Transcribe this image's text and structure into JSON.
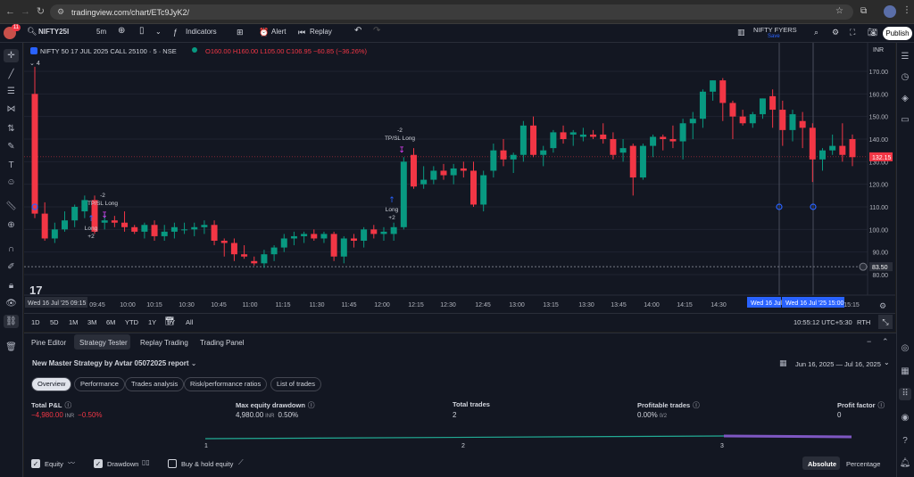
{
  "browser": {
    "url": "tradingview.com/chart/ETc9JyK2/"
  },
  "toolbar": {
    "symbol": "NIFTY25I",
    "interval": "5m",
    "indicators": "Indicators",
    "alert": "Alert",
    "replay": "Replay",
    "broker": "NIFTY FYERS",
    "broker_sub": "Save",
    "publish": "Publish",
    "notif_count": "11"
  },
  "legend": {
    "title": "NIFTY 50 17 JUL 2025 CALL 25100 · 5 · NSE",
    "o": "O160.00",
    "h": "H160.00",
    "l": "L105.00",
    "c": "C106.95",
    "chg": "−60.85 (−36.26%)",
    "indicator_count": "4"
  },
  "chart_data": {
    "type": "candlestick",
    "currency": "INR",
    "y_ticks": [
      80.0,
      90.0,
      100.0,
      110.0,
      120.0,
      130.0,
      140.0,
      150.0,
      160.0,
      170.0
    ],
    "last_price": "132.15",
    "dashed_price": "83.50",
    "x_labels": [
      "09:45",
      "10:00",
      "10:15",
      "10:30",
      "10:45",
      "11:00",
      "11:15",
      "11:30",
      "11:45",
      "12:00",
      "12:15",
      "12:30",
      "12:45",
      "13:00",
      "13:15",
      "13:30",
      "13:45",
      "14:00",
      "14:15",
      "14:30",
      "14:45",
      "15:00",
      "15:15"
    ],
    "x_first": "Wed 16 Jul '25  09:15",
    "x_hover1": "Wed 16 Jul",
    "x_hover2": "Wed 16 Jul '25  15:00",
    "candles": [
      [
        160,
        172,
        105,
        107
      ],
      [
        107,
        112,
        95,
        96
      ],
      [
        96,
        103,
        94,
        100
      ],
      [
        100,
        108,
        99,
        104
      ],
      [
        104,
        111,
        101,
        110
      ],
      [
        108,
        115,
        105,
        113
      ],
      [
        113,
        115,
        98,
        99
      ],
      [
        103,
        107,
        100,
        104
      ],
      [
        104,
        106,
        101,
        103
      ],
      [
        103,
        108,
        99,
        101
      ],
      [
        101,
        102,
        98,
        99
      ],
      [
        99,
        103,
        96,
        102
      ],
      [
        102,
        104,
        95,
        97
      ],
      [
        97,
        102,
        95,
        99
      ],
      [
        99,
        103,
        96,
        101
      ],
      [
        100,
        103,
        98,
        100
      ],
      [
        100,
        103,
        97,
        101
      ],
      [
        101,
        104,
        98,
        102
      ],
      [
        102,
        104,
        93,
        95
      ],
      [
        95,
        96,
        88,
        94
      ],
      [
        94,
        96,
        86,
        89
      ],
      [
        89,
        93,
        87,
        88
      ],
      [
        86,
        88,
        84,
        85
      ],
      [
        85,
        91,
        83,
        89
      ],
      [
        89,
        93,
        86,
        92
      ],
      [
        92,
        98,
        90,
        96
      ],
      [
        96,
        99,
        93,
        97
      ],
      [
        97,
        99,
        94,
        98
      ],
      [
        98,
        100,
        95,
        96
      ],
      [
        96,
        99,
        94,
        98
      ],
      [
        98,
        99,
        86,
        88
      ],
      [
        88,
        97,
        85,
        96
      ],
      [
        96,
        98,
        92,
        95
      ],
      [
        95,
        101,
        92,
        100
      ],
      [
        100,
        102,
        96,
        98
      ],
      [
        98,
        101,
        95,
        99
      ],
      [
        98,
        103,
        95,
        101
      ],
      [
        101,
        132,
        100,
        130
      ],
      [
        133,
        136,
        118,
        119
      ],
      [
        120,
        128,
        118,
        122
      ],
      [
        122,
        128,
        120,
        126
      ],
      [
        126,
        129,
        122,
        124
      ],
      [
        124,
        129,
        120,
        127
      ],
      [
        127,
        130,
        123,
        126
      ],
      [
        126,
        130,
        110,
        111
      ],
      [
        111,
        126,
        108,
        124
      ],
      [
        126,
        138,
        123,
        135
      ],
      [
        135,
        140,
        128,
        131
      ],
      [
        131,
        134,
        125,
        133
      ],
      [
        133,
        148,
        130,
        146
      ],
      [
        146,
        150,
        132,
        133
      ],
      [
        133,
        137,
        128,
        135
      ],
      [
        136,
        144,
        134,
        143
      ],
      [
        143,
        146,
        138,
        140
      ],
      [
        142,
        144,
        137,
        143
      ],
      [
        141,
        145,
        139,
        142
      ],
      [
        142,
        144,
        140,
        141
      ],
      [
        142,
        147,
        138,
        140
      ],
      [
        140,
        143,
        131,
        133
      ],
      [
        134,
        140,
        130,
        136
      ],
      [
        137,
        138,
        115,
        123
      ],
      [
        123,
        138,
        122,
        137
      ],
      [
        137,
        142,
        132,
        141
      ],
      [
        141,
        142,
        135,
        140
      ],
      [
        140,
        146,
        136,
        139
      ],
      [
        139,
        149,
        131,
        147
      ],
      [
        147,
        152,
        140,
        149
      ],
      [
        149,
        162,
        145,
        161
      ],
      [
        161,
        166,
        157,
        166
      ],
      [
        166,
        167,
        148,
        156
      ],
      [
        156,
        157,
        140,
        150
      ],
      [
        150,
        153,
        146,
        147
      ],
      [
        147,
        152,
        145,
        151
      ],
      [
        151,
        158,
        149,
        158
      ],
      [
        159,
        162,
        145,
        153
      ],
      [
        153,
        157,
        137,
        144
      ],
      [
        144,
        153,
        139,
        151
      ],
      [
        148,
        152,
        136,
        145
      ],
      [
        145,
        147,
        121,
        131
      ],
      [
        131,
        136,
        126,
        135
      ],
      [
        135,
        142,
        133,
        137
      ],
      [
        137,
        147,
        130,
        133
      ],
      [
        140,
        142,
        128,
        132
      ]
    ],
    "annotations": [
      {
        "text": "-2",
        "sub": "TP/SL Long",
        "long": "Long",
        "plus": "+2"
      },
      {
        "text": "-2",
        "sub": "TP/SL Long",
        "long": "Long",
        "plus": "+2"
      }
    ]
  },
  "timeframes": {
    "items": [
      "1D",
      "5D",
      "1M",
      "3M",
      "6M",
      "YTD",
      "1Y",
      "5Y",
      "All"
    ],
    "clock": "10:55:12 UTC+5:30",
    "rth": "RTH"
  },
  "bottom_tabs": [
    "Pine Editor",
    "Strategy Tester",
    "Replay Trading",
    "Trading Panel"
  ],
  "report": {
    "title": "New Master Strategy by Avtar 05072025 report",
    "date_range": "Jun 16, 2025 — Jul 16, 2025"
  },
  "subtabs": [
    "Overview",
    "Performance",
    "Trades analysis",
    "Risk/performance ratios",
    "List of trades"
  ],
  "metrics": [
    {
      "label": "Total P&L",
      "value": "−4,980.00",
      "unit": "INR",
      "extra": "−0.50%",
      "color": "#f23645"
    },
    {
      "label": "Max equity drawdown",
      "value": "4,980.00",
      "unit": "INR",
      "extra": "0.50%",
      "color": "#d1d4dc"
    },
    {
      "label": "Total trades",
      "value": "2",
      "unit": "",
      "extra": "",
      "color": "#d1d4dc"
    },
    {
      "label": "Profitable trades",
      "value": "0.00%",
      "unit": "0/2",
      "extra": "",
      "color": "#d1d4dc"
    },
    {
      "label": "Profit factor",
      "value": "0",
      "unit": "",
      "extra": "",
      "color": "#d1d4dc"
    }
  ],
  "equity_axis": [
    "1",
    "2",
    "3"
  ],
  "checkboxes": [
    "Equity",
    "Drawdown",
    "Buy & hold equity"
  ],
  "view_toggle": [
    "Absolute",
    "Percentage"
  ]
}
